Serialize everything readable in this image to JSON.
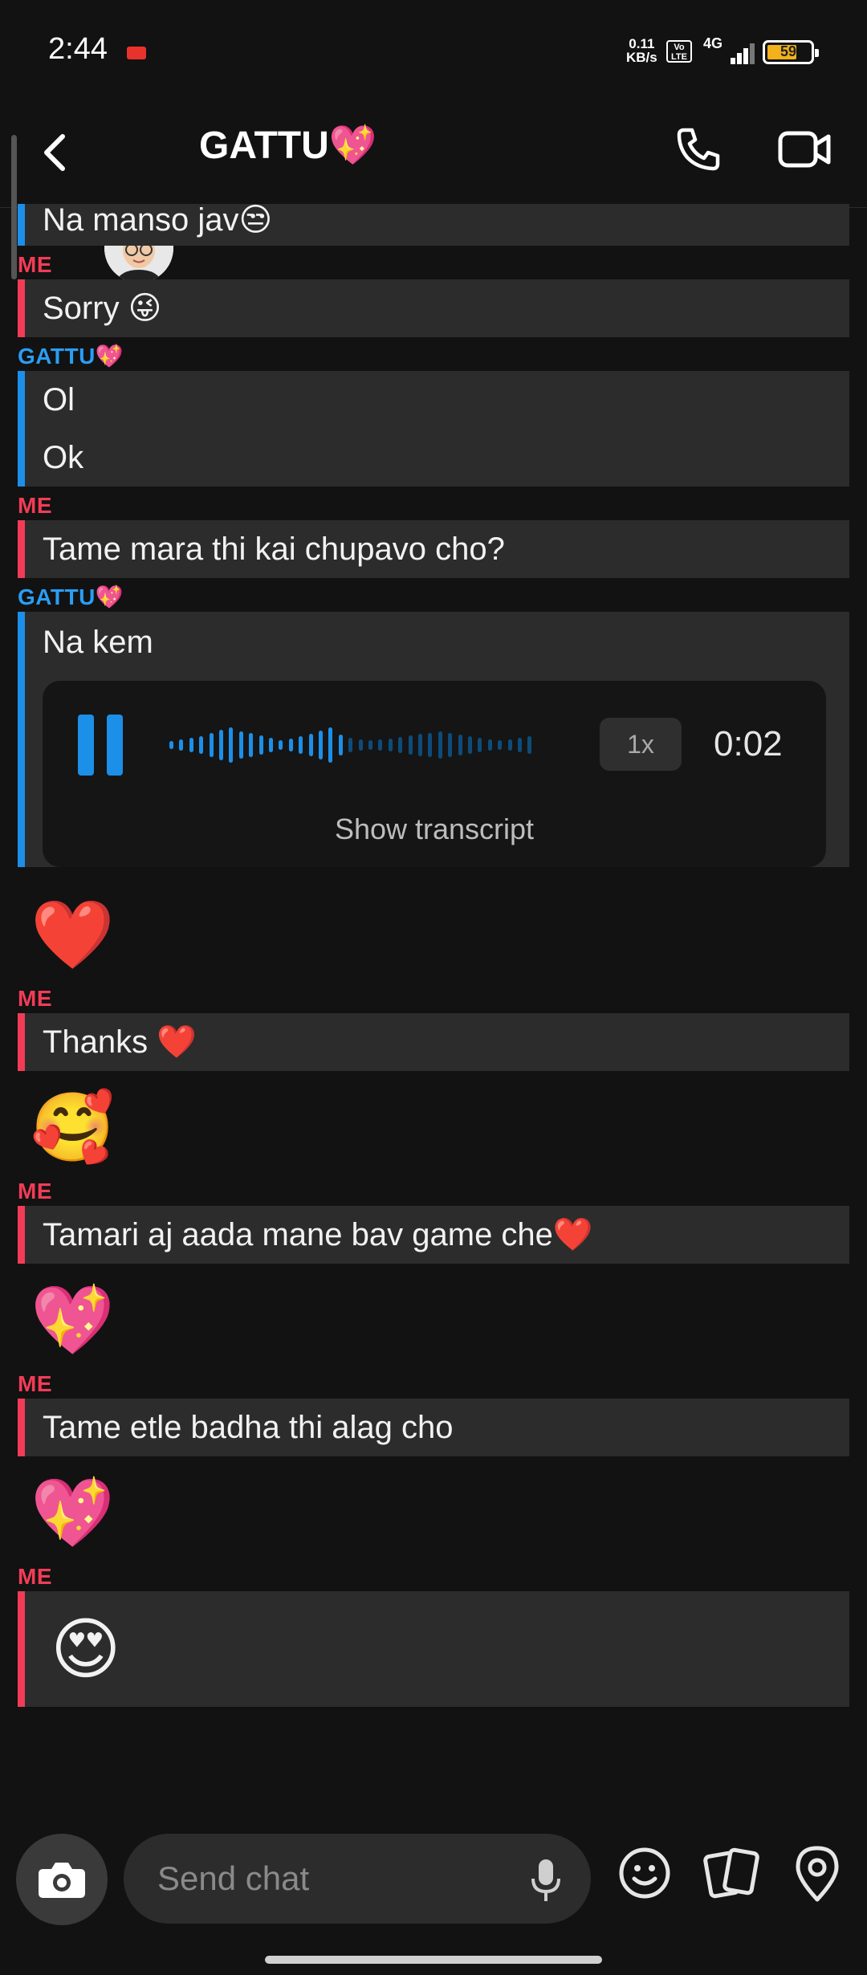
{
  "status_bar": {
    "time": "2:44",
    "net_speed": "0.11",
    "net_unit": "KB/s",
    "volte": "Vo LTE",
    "network": "4G",
    "battery": "59"
  },
  "header": {
    "contact_name": "GATTU💖",
    "icons": [
      "back-icon",
      "avatar",
      "phone-icon",
      "video-icon"
    ]
  },
  "messages": [
    {
      "sender": "",
      "lines": [
        "Na manso jav😒"
      ],
      "side": "them"
    },
    {
      "sender": "ME",
      "lines": [
        "Sorry 😜"
      ],
      "side": "me"
    },
    {
      "sender": "GATTU💖",
      "lines": [
        "Ol",
        "Ok"
      ],
      "side": "them"
    },
    {
      "sender": "ME",
      "lines": [
        "Tame mara thi kai chupavo cho?"
      ],
      "side": "me"
    },
    {
      "sender": "GATTU💖",
      "lines": [
        "Na kem"
      ],
      "side": "them"
    },
    {
      "sender": "ME",
      "lines": [
        "Thanks ❤️"
      ],
      "side": "me"
    },
    {
      "sender": "ME",
      "lines": [
        "Tamari aj aada mane bav game che❤️"
      ],
      "side": "me"
    },
    {
      "sender": "ME",
      "lines": [
        "Tame etle badha thi alag cho"
      ],
      "side": "me"
    },
    {
      "sender": "ME",
      "lines": [
        "😍"
      ],
      "side": "me"
    }
  ],
  "voice_note": {
    "speed": "1x",
    "duration": "0:02",
    "transcript_label": "Show transcript"
  },
  "reactions": [
    "❤️",
    "🥰",
    "💖",
    "💖"
  ],
  "composer": {
    "placeholder": "Send chat",
    "icons": [
      "camera-icon",
      "microphone-icon",
      "smiley-icon",
      "cards-icon",
      "location-pin-icon"
    ]
  },
  "colors": {
    "me_accent": "#f23c57",
    "them_accent": "#1c8fe8",
    "bubble_bg": "#2c2c2c",
    "app_bg": "#121212"
  }
}
